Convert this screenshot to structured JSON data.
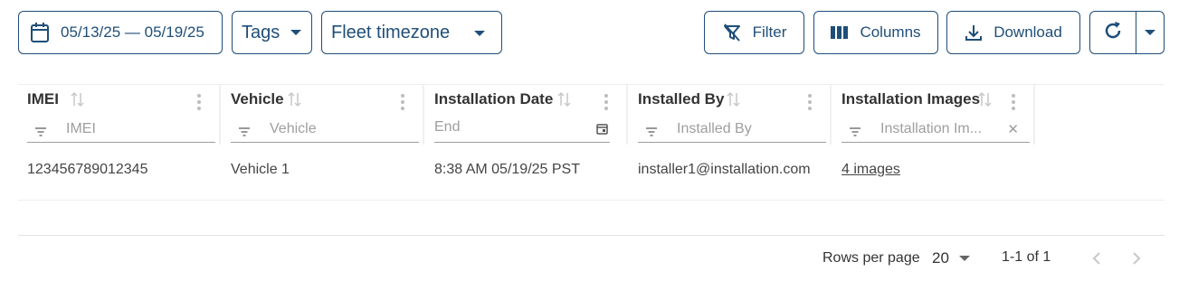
{
  "toolbar": {
    "date_range": "05/13/25 — 05/19/25",
    "tags_label": "Tags",
    "timezone_label": "Fleet timezone",
    "filter_label": "Filter",
    "columns_label": "Columns",
    "download_label": "Download"
  },
  "columns": [
    {
      "title": "IMEI",
      "filter_placeholder": "IMEI"
    },
    {
      "title": "Vehicle",
      "filter_placeholder": "Vehicle"
    },
    {
      "title": "Installation Date",
      "filter_placeholder": "End"
    },
    {
      "title": "Installed By",
      "filter_placeholder": "Installed By"
    },
    {
      "title": "Installation Images",
      "filter_placeholder": "Installation Im..."
    }
  ],
  "rows": [
    {
      "imei": "123456789012345",
      "vehicle": "Vehicle 1",
      "installation_date": "8:38 AM 05/19/25 PST",
      "installed_by": "installer1@installation.com",
      "images": "4 images"
    }
  ],
  "footer": {
    "rows_per_page_label": "Rows per page",
    "rows_per_page_value": "20",
    "page_info": "1-1 of 1"
  },
  "colors": {
    "accent": "#1f4e79"
  }
}
